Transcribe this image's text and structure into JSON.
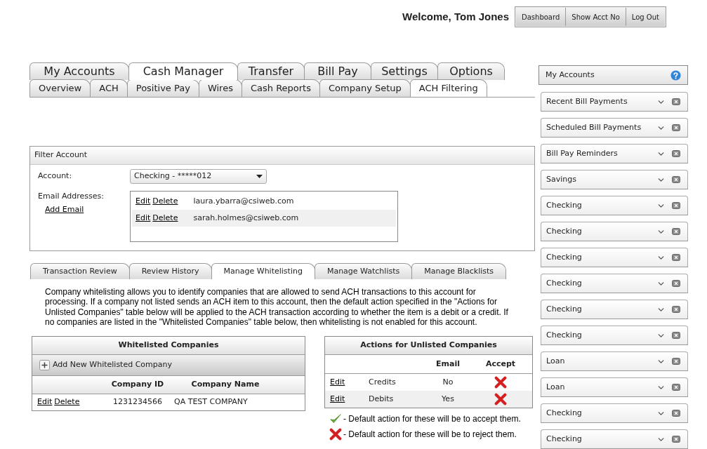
{
  "header": {
    "welcome": "Welcome, Tom Jones",
    "buttons": [
      "Dashboard",
      "Show Acct No",
      "Log Out"
    ]
  },
  "main_tabs": [
    {
      "label": "My Accounts",
      "selected": false
    },
    {
      "label": "Cash Manager",
      "selected": true
    },
    {
      "label": "Transfer",
      "selected": false
    },
    {
      "label": "Bill Pay",
      "selected": false
    },
    {
      "label": "Settings",
      "selected": false
    },
    {
      "label": "Options",
      "selected": false
    }
  ],
  "sub_tabs": [
    {
      "label": "Overview",
      "selected": false
    },
    {
      "label": "ACH",
      "selected": false
    },
    {
      "label": "Positive Pay",
      "selected": false
    },
    {
      "label": "Wires",
      "selected": false
    },
    {
      "label": "Cash Reports",
      "selected": false
    },
    {
      "label": "Company Setup",
      "selected": false
    },
    {
      "label": "ACH Filtering",
      "selected": true
    }
  ],
  "filter_account": {
    "title": "Filter Account",
    "account_label": "Account:",
    "account_value": "Checking - *****012",
    "email_label": "Email Addresses:",
    "add_email_link": "Add Email",
    "emails": [
      {
        "edit": "Edit",
        "delete": "Delete",
        "address": "laura.ybarra@csiweb.com"
      },
      {
        "edit": "Edit",
        "delete": "Delete",
        "address": "sarah.holmes@csiweb.com"
      }
    ]
  },
  "section_tabs": [
    {
      "label": "Transaction Review",
      "selected": false
    },
    {
      "label": "Review History",
      "selected": false
    },
    {
      "label": "Manage Whitelisting",
      "selected": true
    },
    {
      "label": "Manage Watchlists",
      "selected": false
    },
    {
      "label": "Manage Blacklists",
      "selected": false
    }
  ],
  "description": "Company whitelisting allows you to identify companies that are allowed to send ACH transactions to this account for processing. If a company not listed sends an ACH item to this account, then the default action specified in the \"Actions for Unlisted Companies\" table below will be applied to the ACH transaction according to whether the item is a debit or a credit. If no companies are listed in the \"Whitelisted Companies\" table below, then whitelisting is not enabled for this account.",
  "whitelisted_companies": {
    "title": "Whitelisted Companies",
    "add_button": "Add New Whitelisted Company",
    "columns": [
      "Company ID",
      "Company Name"
    ],
    "rows": [
      {
        "edit": "Edit",
        "delete": "Delete",
        "company_id": "1231234566",
        "company_name": "QA TEST COMPANY"
      }
    ]
  },
  "unlisted_actions": {
    "title": "Actions for Unlisted Companies",
    "columns": [
      "Email",
      "Accept"
    ],
    "rows": [
      {
        "edit": "Edit",
        "type": "Credits",
        "email": "No",
        "accept": false
      },
      {
        "edit": "Edit",
        "type": "Debits",
        "email": "Yes",
        "accept": false
      }
    ]
  },
  "legend": [
    {
      "kind": "accept",
      "text": "- Default action for these will be to accept them."
    },
    {
      "kind": "reject",
      "text": "- Default action for these will be to reject them."
    }
  ],
  "sidebar": {
    "title": "My Accounts",
    "widgets": [
      "Recent Bill Payments",
      "Scheduled Bill Payments",
      "Bill Pay Reminders",
      "Savings",
      "Checking",
      "Checking",
      "Checking",
      "Checking",
      "Checking",
      "Checking",
      "Loan",
      "Loan",
      "Checking",
      "Checking"
    ]
  }
}
